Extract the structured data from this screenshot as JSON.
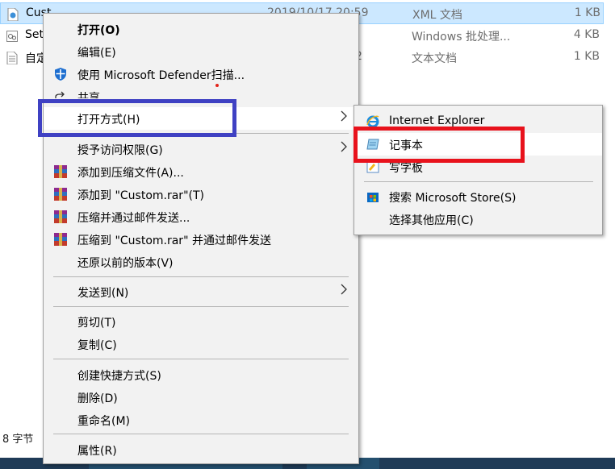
{
  "files": [
    {
      "name": "Cust",
      "date": "2019/10/17 20:59",
      "type": "XML 文档",
      "size": "1 KB",
      "icon": "xml-file-icon",
      "selected": true
    },
    {
      "name": "Set",
      "date": "",
      "type": "Windows 批处理...",
      "size": "4 KB",
      "icon": "batch-file-icon",
      "selected": false
    },
    {
      "name": "自定",
      "date": "2",
      "type": "文本文档",
      "size": "1 KB",
      "icon": "text-file-icon",
      "selected": false
    }
  ],
  "status_bar": {
    "text": "8 字节"
  },
  "context_menu": {
    "items": [
      {
        "label": "打开(O)",
        "bold": true
      },
      {
        "label": "编辑(E)"
      },
      {
        "label": "使用 Microsoft Defender扫描...",
        "icon": "defender-shield-icon"
      },
      {
        "label": "共享",
        "icon": "share-icon"
      },
      {
        "label": "打开方式(H)",
        "submenu": true,
        "active": true
      },
      {
        "label": "授予访问权限(G)",
        "submenu": true
      },
      {
        "label": "添加到压缩文件(A)...",
        "icon": "winrar-icon"
      },
      {
        "label": "添加到 \"Custom.rar\"(T)",
        "icon": "winrar-icon"
      },
      {
        "label": "压缩并通过邮件发送...",
        "icon": "winrar-icon"
      },
      {
        "label": "压缩到 \"Custom.rar\" 并通过邮件发送",
        "icon": "winrar-icon"
      },
      {
        "label": "还原以前的版本(V)"
      },
      {
        "label": "发送到(N)",
        "submenu": true
      },
      {
        "label": "剪切(T)"
      },
      {
        "label": "复制(C)"
      },
      {
        "label": "创建快捷方式(S)"
      },
      {
        "label": "删除(D)"
      },
      {
        "label": "重命名(M)"
      },
      {
        "label": "属性(R)"
      }
    ]
  },
  "open_with_submenu": {
    "items": [
      {
        "label": "Internet Explorer",
        "icon": "internet-explorer-icon"
      },
      {
        "label": "记事本",
        "icon": "notepad-icon",
        "hover": true
      },
      {
        "label": "写字板",
        "icon": "wordpad-icon"
      },
      {
        "label": "搜索 Microsoft Store(S)",
        "icon": "microsoft-store-icon"
      },
      {
        "label": "选择其他应用(C)"
      }
    ]
  },
  "colors": {
    "selection": "#cce8ff",
    "highlight_blue": "#3f41c3",
    "highlight_red": "#e8121c",
    "menu_bg": "#f2f2f2"
  }
}
